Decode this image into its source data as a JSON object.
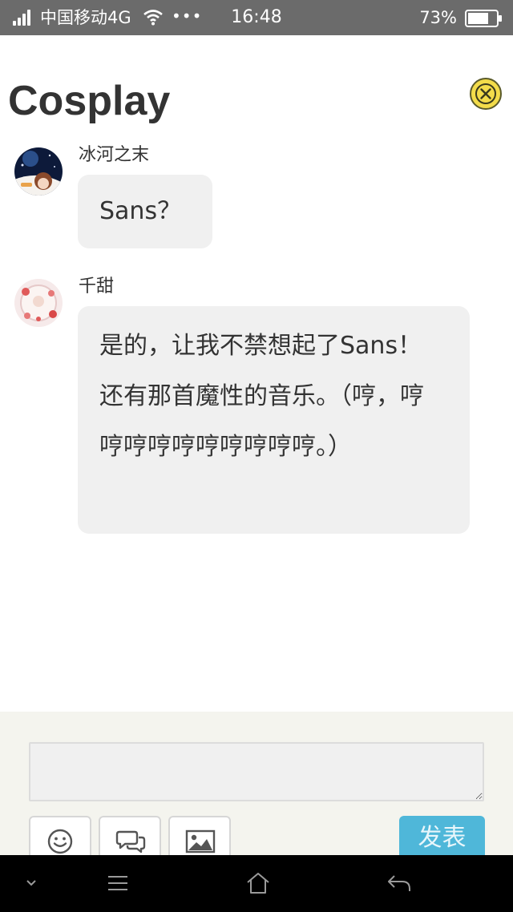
{
  "status_bar": {
    "carrier": "中国移动4G",
    "dots": "•••",
    "time": "16:48",
    "battery_percent": "73%"
  },
  "header": {
    "title": "Cosplay",
    "close_icon": "close-circle-icon"
  },
  "messages": [
    {
      "sender": "冰河之末",
      "text": "Sans？",
      "avatar": "anime-avatar-dark"
    },
    {
      "sender": "千甜",
      "text": "是的，让我不禁想起了Sans！还有那首魔性的音乐。（哼，哼哼哼哼哼哼哼哼哼哼。）",
      "avatar": "anime-avatar-pink"
    }
  ],
  "composer": {
    "input_value": "",
    "tools": [
      "smiley-icon",
      "chat-bubbles-icon",
      "image-icon"
    ],
    "send_label": "发表"
  },
  "nav_bar": {
    "icons": [
      "chevron-down-icon",
      "menu-icon",
      "home-icon",
      "back-icon"
    ]
  },
  "colors": {
    "status_bar": "#6b6b6b",
    "close_button": "#f3dc4a",
    "bubble": "#f0f0f0",
    "send_button": "#4fb7d9",
    "composer_bg": "#f4f4ee"
  }
}
